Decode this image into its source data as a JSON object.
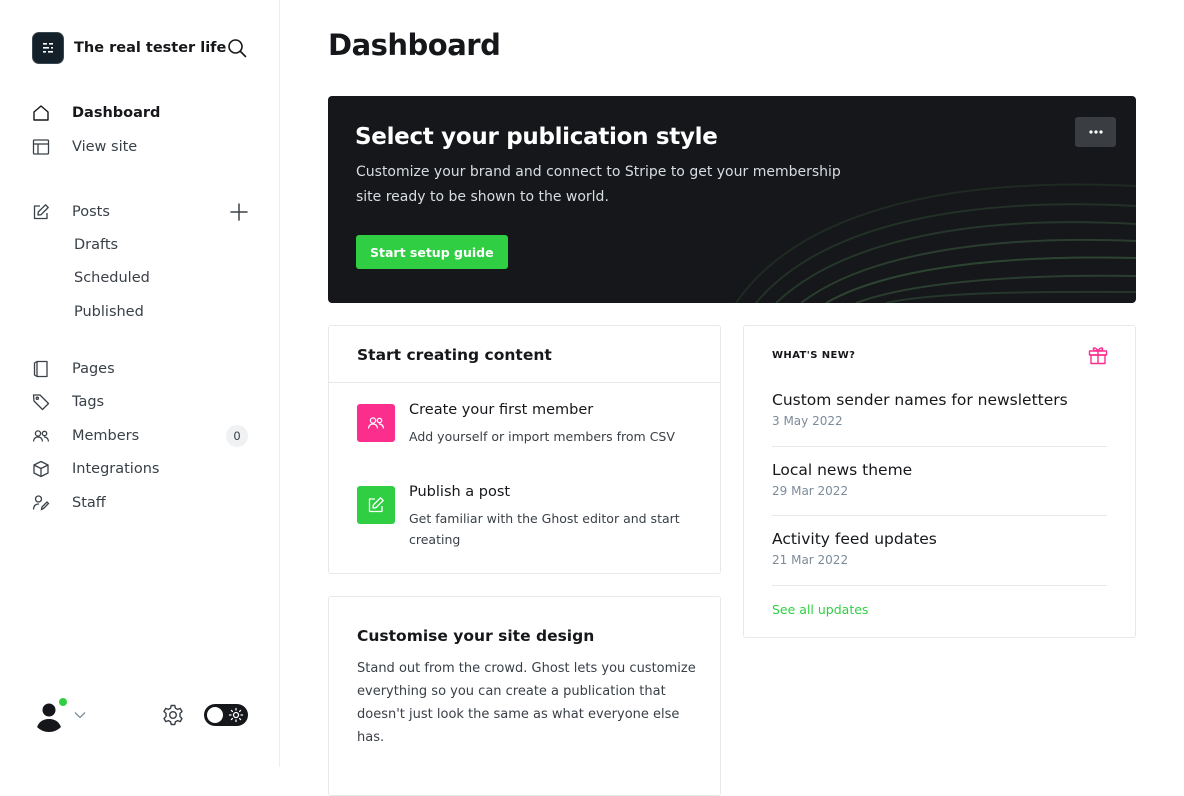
{
  "app": {
    "site_title": "The real tester life"
  },
  "sidebar": {
    "nav_top": [
      {
        "label": "Dashboard",
        "icon": "home-icon",
        "active": true
      },
      {
        "label": "View site",
        "icon": "layout-icon",
        "active": false
      }
    ],
    "posts": {
      "label": "Posts",
      "icon": "pencil-square-icon",
      "add_icon": "plus-icon",
      "sub_items": [
        "Drafts",
        "Scheduled",
        "Published"
      ]
    },
    "nav_bottom": [
      {
        "label": "Pages",
        "icon": "page-icon"
      },
      {
        "label": "Tags",
        "icon": "tag-icon"
      },
      {
        "label": "Members",
        "icon": "members-icon",
        "badge": "0"
      },
      {
        "label": "Integrations",
        "icon": "cube-icon"
      },
      {
        "label": "Staff",
        "icon": "staff-icon"
      }
    ],
    "footer": {
      "avatar_icon": "user-avatar-icon",
      "status": "online",
      "settings_icon": "gear-icon",
      "theme_toggle_icon": "sun-icon"
    }
  },
  "main": {
    "page_title": "Dashboard",
    "hero": {
      "title": "Select your publication style",
      "description": "Customize your brand and connect to Stripe to get your membership site ready to be shown to the world.",
      "button_label": "Start setup guide",
      "more_icon": "ellipsis-icon"
    },
    "start_creating": {
      "title": "Start creating content",
      "tasks": [
        {
          "title": "Create your first member",
          "description": "Add yourself or import members from CSV",
          "icon": "members-icon",
          "color": "#fb2d8d"
        },
        {
          "title": "Publish a post",
          "description": "Get familiar with the Ghost editor and start creating",
          "icon": "pencil-square-icon",
          "color": "#30cf43"
        }
      ]
    },
    "customise": {
      "title": "Customise your site design",
      "description": "Stand out from the crowd. Ghost lets you customize everything so you can create a publication that doesn't just look the same as what everyone else has."
    },
    "whats_new": {
      "kicker": "WHAT'S NEW?",
      "gift_icon": "gift-icon",
      "items": [
        {
          "title": "Custom sender names for newsletters",
          "date": "3 May 2022"
        },
        {
          "title": "Local news theme",
          "date": "29 Mar 2022"
        },
        {
          "title": "Activity feed updates",
          "date": "21 Mar 2022"
        }
      ],
      "see_all": "See all updates"
    }
  },
  "colors": {
    "accent_green": "#30cf43",
    "accent_pink": "#fb2d8d",
    "dark": "#15171a",
    "text": "#394047",
    "muted": "#7c8b9a"
  }
}
